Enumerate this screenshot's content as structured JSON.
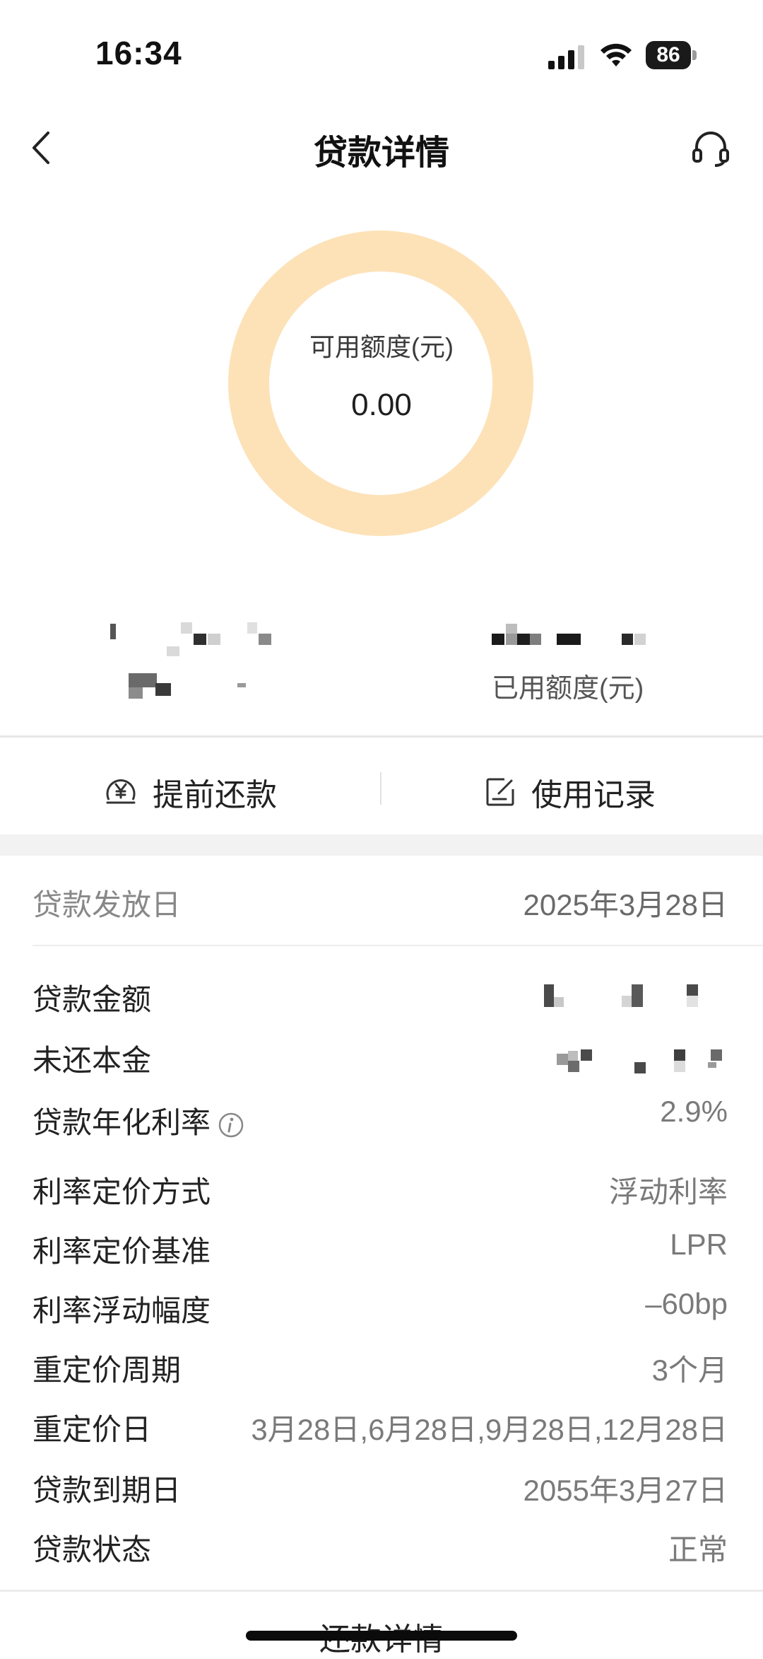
{
  "status_bar": {
    "time": "16:34",
    "battery": "86"
  },
  "nav": {
    "title": "贷款详情"
  },
  "credit": {
    "label": "可用额度(元)",
    "value": "0.00",
    "used_label": "已用额度(元)"
  },
  "actions": {
    "prepay": "提前还款",
    "records": "使用记录"
  },
  "details": {
    "disburse_label": "贷款发放日",
    "disburse_value": "2025年3月28日",
    "amount_label": "贷款金额",
    "principal_label": "未还本金",
    "rate_label": "贷款年化利率",
    "rate_value": "2.9%",
    "pricing_method_label": "利率定价方式",
    "pricing_method_value": "浮动利率",
    "pricing_base_label": "利率定价基准",
    "pricing_base_value": "LPR",
    "float_label": "利率浮动幅度",
    "float_value": "–60bp",
    "reprice_cycle_label": "重定价周期",
    "reprice_cycle_value": "3个月",
    "reprice_date_label": "重定价日",
    "reprice_date_value": "3月28日,6月28日,9月28日,12月28日",
    "maturity_label": "贷款到期日",
    "maturity_value": "2055年3月27日",
    "status_label": "贷款状态",
    "status_value": "正常"
  },
  "footer": {
    "link": "还款详情"
  },
  "colors": {
    "donut": "#fde2b8",
    "gap": "#f2f2f2"
  }
}
